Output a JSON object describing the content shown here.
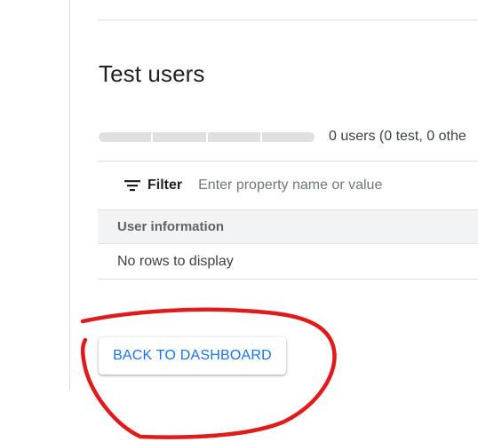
{
  "section": {
    "title": "Test users"
  },
  "progress": {
    "segments": 4,
    "summary": "0 users (0 test, 0 othe"
  },
  "filter": {
    "label": "Filter",
    "icon": "filter-list-icon",
    "placeholder": "Enter property name or value",
    "value": ""
  },
  "table": {
    "columns": [
      "User information"
    ],
    "empty_message": "No rows to display"
  },
  "actions": {
    "back_label": "BACK TO DASHBOARD"
  },
  "annotation": {
    "color": "#e01b1b"
  },
  "colors": {
    "accent": "#1a73e8",
    "header_bg": "#f1f3f4",
    "divider": "#e0e0e0"
  }
}
